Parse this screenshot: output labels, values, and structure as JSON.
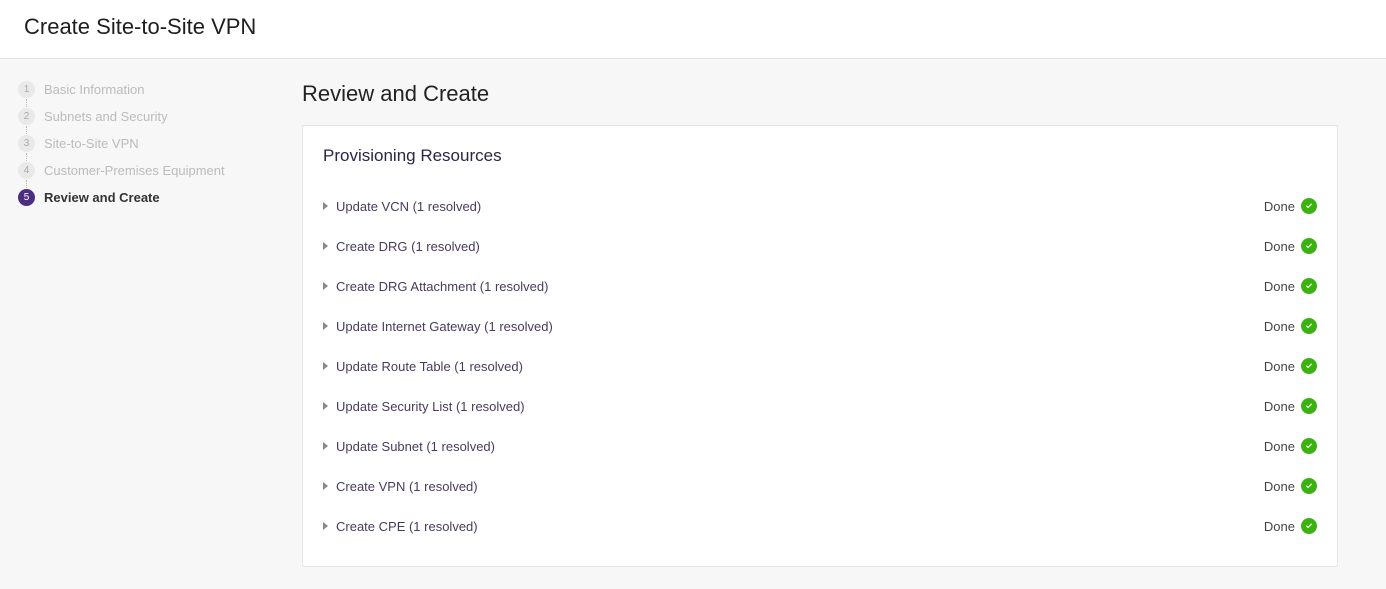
{
  "header": {
    "title": "Create Site-to-Site VPN"
  },
  "sidebar": {
    "steps": [
      {
        "num": "1",
        "label": "Basic Information",
        "state": "past"
      },
      {
        "num": "2",
        "label": "Subnets and Security",
        "state": "past"
      },
      {
        "num": "3",
        "label": "Site-to-Site VPN",
        "state": "past"
      },
      {
        "num": "4",
        "label": "Customer-Premises Equipment",
        "state": "past"
      },
      {
        "num": "5",
        "label": "Review and Create",
        "state": "current"
      }
    ]
  },
  "main": {
    "heading": "Review and Create",
    "panel_heading": "Provisioning Resources",
    "resources": [
      {
        "label": "Update VCN (1 resolved)",
        "status": "Done"
      },
      {
        "label": "Create DRG (1 resolved)",
        "status": "Done"
      },
      {
        "label": "Create DRG Attachment (1 resolved)",
        "status": "Done"
      },
      {
        "label": "Update Internet Gateway (1 resolved)",
        "status": "Done"
      },
      {
        "label": "Update Route Table (1 resolved)",
        "status": "Done"
      },
      {
        "label": "Update Security List (1 resolved)",
        "status": "Done"
      },
      {
        "label": "Update Subnet (1 resolved)",
        "status": "Done"
      },
      {
        "label": "Create VPN (1 resolved)",
        "status": "Done"
      },
      {
        "label": "Create CPE (1 resolved)",
        "status": "Done"
      }
    ]
  }
}
